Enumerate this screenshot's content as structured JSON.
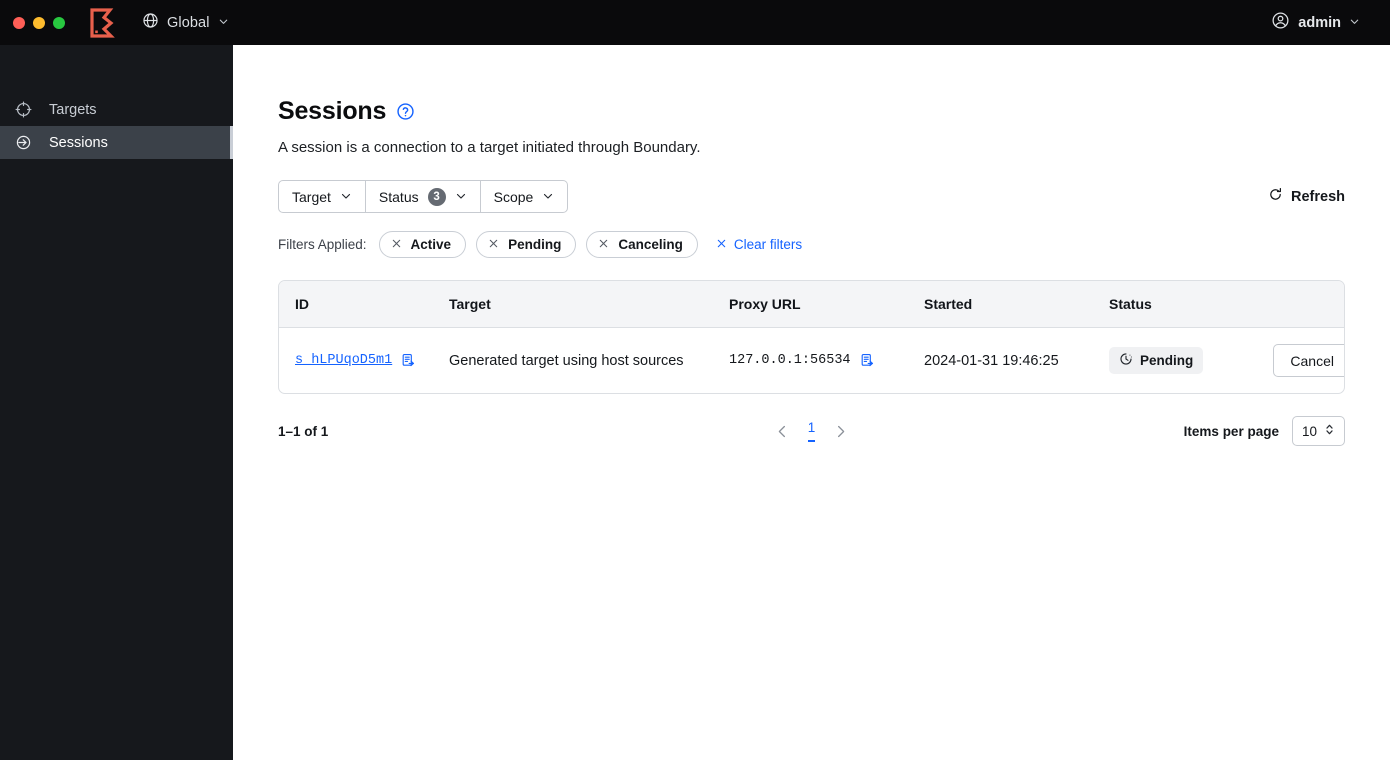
{
  "window": {
    "traffic_lights": [
      "close",
      "minimize",
      "zoom"
    ],
    "colors": {
      "close": "#ff5f57",
      "minimize": "#febc2e",
      "zoom": "#28c840",
      "brand": "#e8604c",
      "accent": "#1563ff",
      "topbar_bg": "#0a0a0c",
      "sidebar_bg": "#16181c",
      "sidebar_active_bg": "#3b4149"
    }
  },
  "topbar": {
    "logo_name": "boundary-logo",
    "scope": {
      "icon": "globe-icon",
      "label": "Global",
      "chevron": "chevron-down-icon"
    },
    "user": {
      "icon": "user-circle-icon",
      "label": "admin",
      "chevron": "chevron-down-icon"
    }
  },
  "sidebar": {
    "items": [
      {
        "label": "Targets",
        "icon": "target-icon",
        "active": false
      },
      {
        "label": "Sessions",
        "icon": "login-arrow-icon",
        "active": true
      }
    ]
  },
  "page": {
    "title": "Sessions",
    "help_icon": "help-circle-icon",
    "description": "A session is a connection to a target initiated through Boundary."
  },
  "filters": {
    "buttons": [
      {
        "label": "Target",
        "badge": null,
        "chevron": "chevron-down-icon"
      },
      {
        "label": "Status",
        "badge": "3",
        "chevron": "chevron-down-icon"
      },
      {
        "label": "Scope",
        "badge": null,
        "chevron": "chevron-down-icon"
      }
    ],
    "refresh": {
      "label": "Refresh",
      "icon": "refresh-icon"
    },
    "applied_label": "Filters Applied:",
    "applied": [
      {
        "label": "Active",
        "remove_icon": "close-x-icon"
      },
      {
        "label": "Pending",
        "remove_icon": "close-x-icon"
      },
      {
        "label": "Canceling",
        "remove_icon": "close-x-icon"
      }
    ],
    "clear": {
      "label": "Clear filters",
      "icon": "close-x-icon"
    }
  },
  "table": {
    "columns": [
      "ID",
      "Target",
      "Proxy URL",
      "Started",
      "Status"
    ],
    "rows": [
      {
        "id": "s_hLPUqoD5m1",
        "id_copy_icon": "copy-icon",
        "target": "Generated target using host sources",
        "proxy_url": "127.0.0.1:56534",
        "proxy_copy_icon": "copy-icon",
        "started": "2024-01-31 19:46:25",
        "status": {
          "label": "Pending",
          "icon": "clock-icon"
        },
        "action": "Cancel"
      }
    ]
  },
  "pagination": {
    "range": "1–1 of 1",
    "prev_icon": "chevron-left-icon",
    "next_icon": "chevron-right-icon",
    "current_page": "1",
    "per_page_label": "Items per page",
    "per_page_value": "10",
    "per_page_icon": "chevron-updown-icon"
  }
}
